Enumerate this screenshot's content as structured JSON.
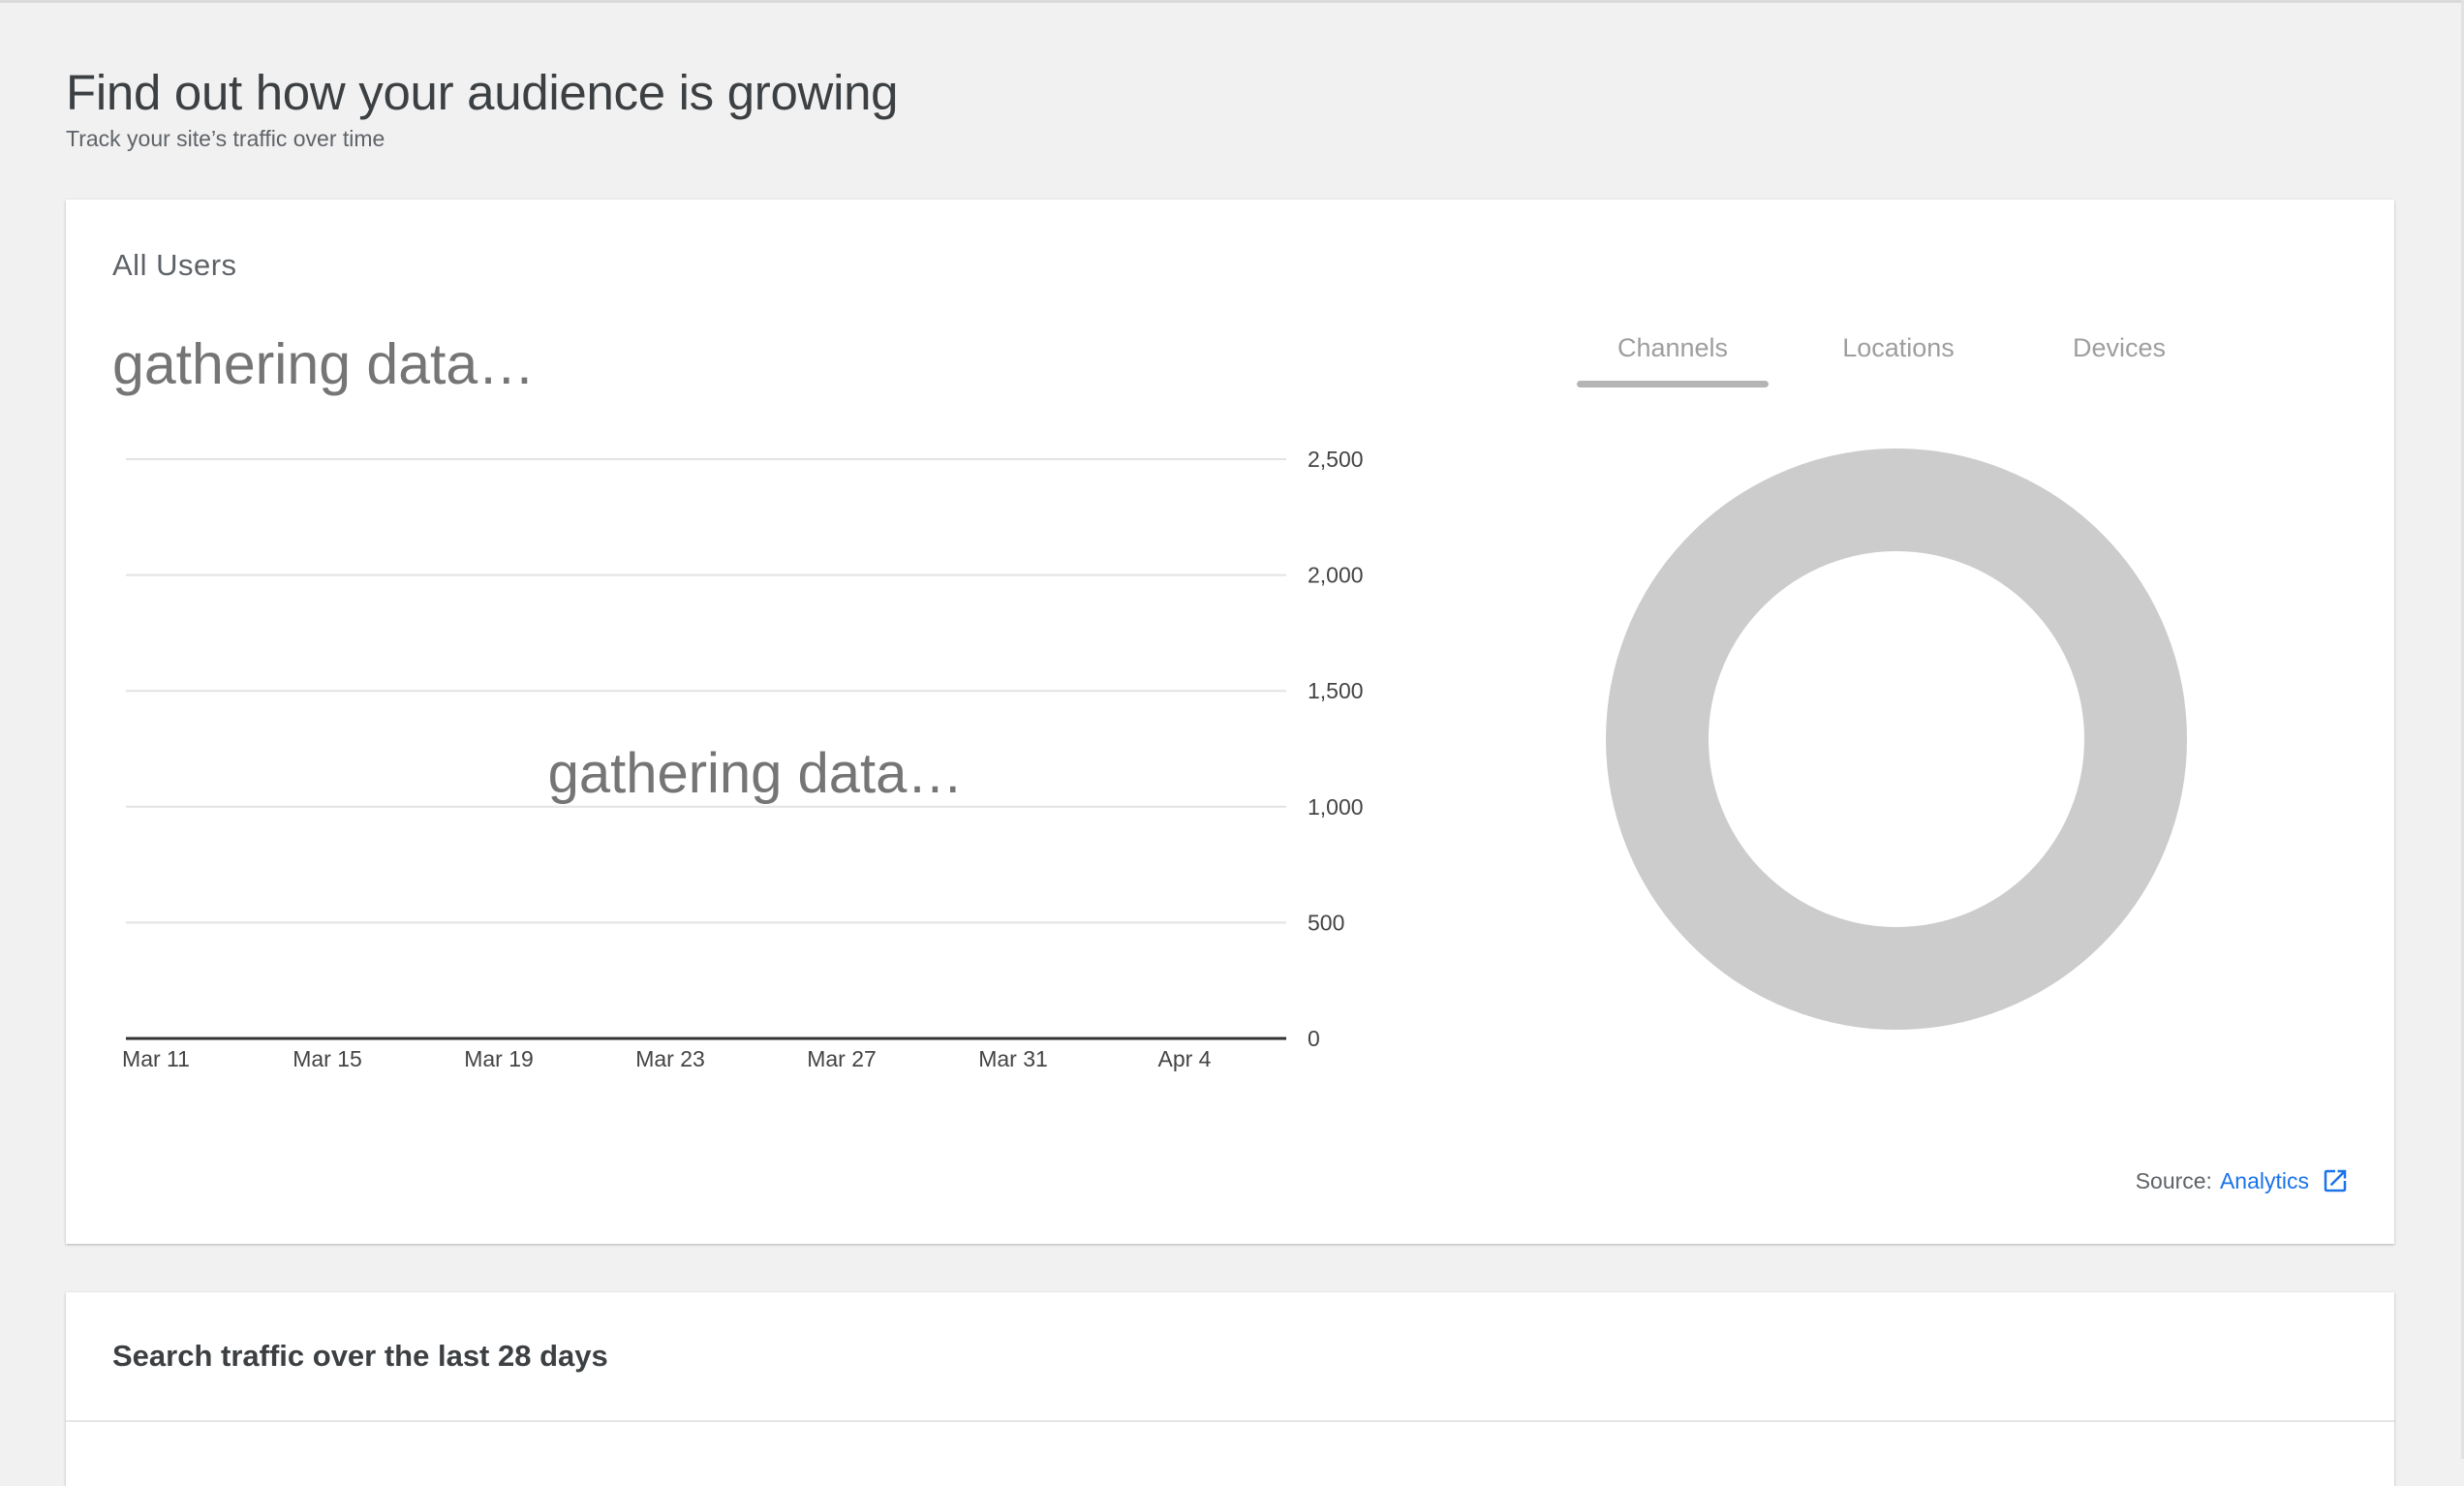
{
  "header": {
    "title": "Find out how your audience is growing",
    "subtitle": "Track your site’s traffic over time"
  },
  "users_card": {
    "label": "All Users",
    "status": "gathering data…",
    "chart_overlay": "gathering data…",
    "tabs": [
      {
        "label": "Channels",
        "active": true
      },
      {
        "label": "Locations",
        "active": false
      },
      {
        "label": "Devices",
        "active": false
      }
    ],
    "source_label": "Source:",
    "source_link": "Analytics",
    "donut_color": "#cccccc"
  },
  "chart_data": {
    "type": "line",
    "title": "",
    "x_ticks": [
      "Mar 11",
      "Mar 15",
      "Mar 19",
      "Mar 23",
      "Mar 27",
      "Mar 31",
      "Apr 4"
    ],
    "y_ticks": [
      "2,500",
      "2,000",
      "1,500",
      "1,000",
      "500",
      "0"
    ],
    "y_tick_values": [
      2500,
      2000,
      1500,
      1000,
      500,
      0
    ],
    "ylim": [
      0,
      2500
    ],
    "y_axis_position": "right",
    "grid": true,
    "series": []
  },
  "search_card": {
    "title": "Search traffic over the last 28 days"
  },
  "colors": {
    "accent": "#1a73e8",
    "tab_inactive": "#9e9e9e",
    "donut": "#cccccc"
  }
}
